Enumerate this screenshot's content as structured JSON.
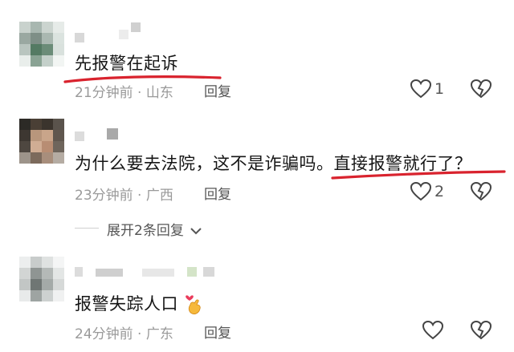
{
  "comments": [
    {
      "text": "先报警在起诉",
      "meta": "21分钟前 · 山东",
      "reply_label": "回复",
      "likes": "1"
    },
    {
      "text_main": "为什么要去法院，这不是诈骗吗。",
      "text_tail": "直接报警就行了？",
      "meta": "23分钟前 · 广西",
      "reply_label": "回复",
      "likes": "2",
      "expand_label": "展开2条回复"
    },
    {
      "text": "报警失踪人口",
      "meta": "24分钟前 · 广东",
      "reply_label": "回复",
      "likes": ""
    }
  ],
  "colors": {
    "underline": "#d9232e",
    "meta": "#9a9a9a"
  },
  "icons": [
    "like-heart-icon",
    "dislike-broken-heart-icon",
    "chevron-down-icon",
    "heart-hand-emoji-icon"
  ]
}
